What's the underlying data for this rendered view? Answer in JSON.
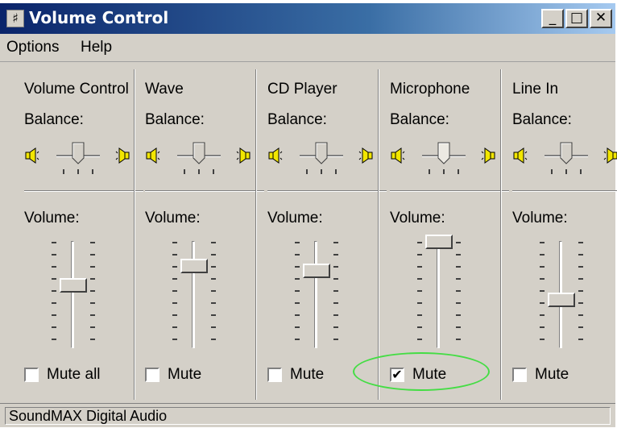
{
  "window": {
    "title": "Volume Control",
    "icon": "volume-control-icon",
    "buttons": {
      "minimize": "_",
      "maximize": "□",
      "close": "✕"
    }
  },
  "menu": [
    "Options",
    "Help"
  ],
  "channels": [
    {
      "name": "Volume Control",
      "balance_label": "Balance:",
      "volume_label": "Volume:",
      "mute_label": "Mute all",
      "muted": false,
      "volume_level": 0.55,
      "balance": 0.5
    },
    {
      "name": "Wave",
      "balance_label": "Balance:",
      "volume_label": "Volume:",
      "mute_label": "Mute",
      "muted": false,
      "volume_level": 0.75,
      "balance": 0.5
    },
    {
      "name": "CD Player",
      "balance_label": "Balance:",
      "volume_label": "Volume:",
      "mute_label": "Mute",
      "muted": false,
      "volume_level": 0.7,
      "balance": 0.5
    },
    {
      "name": "Microphone",
      "balance_label": "Balance:",
      "volume_label": "Volume:",
      "mute_label": "Mute",
      "muted": true,
      "volume_level": 1.0,
      "balance": 0.5
    },
    {
      "name": "Line In",
      "balance_label": "Balance:",
      "volume_label": "Volume:",
      "mute_label": "Mute",
      "muted": false,
      "volume_level": 0.4,
      "balance": 0.5
    }
  ],
  "status": "SoundMAX Digital Audio",
  "colors": {
    "titlebar_start": "#0a246a",
    "titlebar_end": "#a6caf0",
    "face": "#d4d0c8",
    "highlight_ring": "#44dd44"
  }
}
